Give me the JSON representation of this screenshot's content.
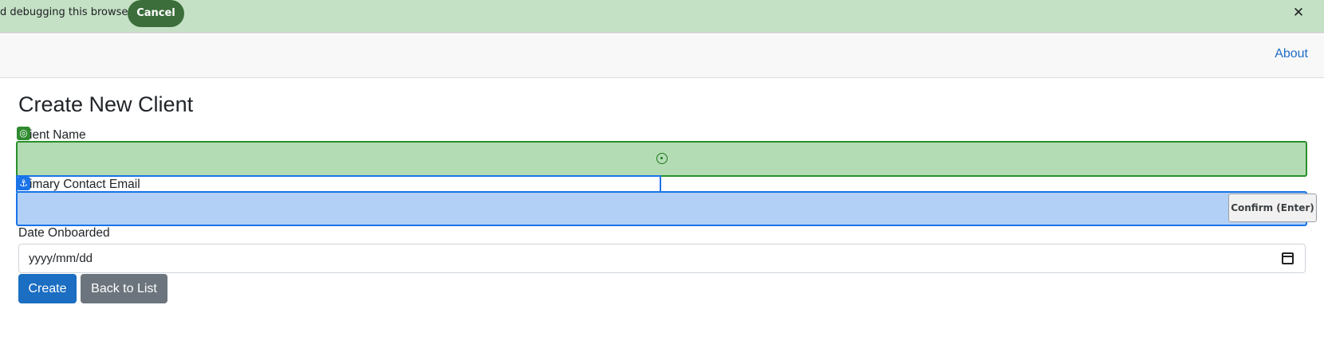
{
  "infobar": {
    "message": "d debugging this browser",
    "cancel_label": "Cancel",
    "close_glyph": "✕"
  },
  "navbar": {
    "about_label": "About"
  },
  "page": {
    "title": "Create New Client"
  },
  "form": {
    "client_name": {
      "label": "Client Name",
      "visible_label": "ient Name",
      "value": ""
    },
    "primary_contact_email": {
      "label": "Primary Contact Email",
      "visible_label": "imary Contact Email",
      "value": ""
    },
    "date_onboarded": {
      "label": "Date Onboarded",
      "placeholder": "yyyy/mm/dd"
    },
    "create_label": "Create",
    "back_label": "Back to List"
  },
  "overlay": {
    "confirm_label": "Confirm (Enter)",
    "green_badge_icon": "target-icon",
    "blue_badge_icon": "anchor-icon",
    "green_badge_glyph": "◎",
    "blue_badge_glyph": "⚓",
    "highlight_green": "#b4dcb4",
    "highlight_blue": "#b2d0f5"
  },
  "colors": {
    "infobar_bg": "#c4e1c5",
    "cancel_bg": "#3c6e3b",
    "primary": "#1b6ec2",
    "secondary": "#6c757d",
    "link": "#1f6ec4"
  }
}
